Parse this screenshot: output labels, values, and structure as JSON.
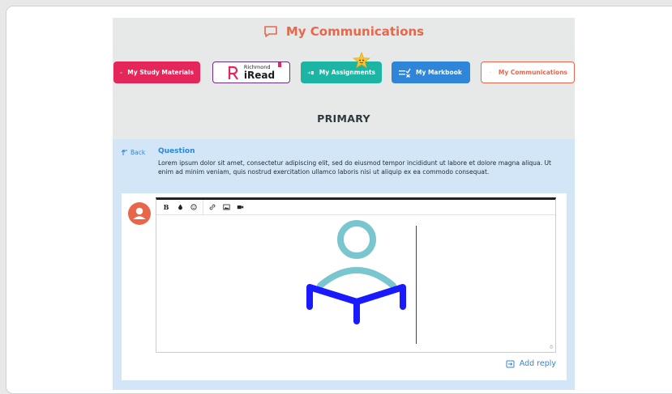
{
  "header": {
    "title": "My Communications"
  },
  "nav": {
    "study_materials": "My Study Materials",
    "iread_top": "Richmond",
    "iread_main": "iRead",
    "assignments": "My Assignments",
    "markbook": "My Markbook",
    "communications": "My Communications"
  },
  "level": "PRIMARY",
  "question": {
    "back_label": "Back",
    "title": "Question",
    "text": "Lorem ipsum dolor sit amet, consectetur adipiscing elit, sed do eiusmod tempor incididunt ut labore et dolore magna aliqua. Ut enim ad minim veniam, quis nostrud exercitation ullamco laboris nisi ut aliquip ex ea commodo consequat."
  },
  "editor": {
    "toolbar": [
      "B",
      "color-drop-icon",
      "emoji-icon",
      "link-icon",
      "image-icon",
      "video-icon"
    ],
    "char_count": "0"
  },
  "reply": {
    "add_label": "Add reply"
  },
  "colors": {
    "accent": "#e8674a",
    "blue": "#2f86d8",
    "study": "#e5265a",
    "assign": "#1cb5a4",
    "iread": "#6b2c8c",
    "question_bg": "#d3e6f8"
  }
}
